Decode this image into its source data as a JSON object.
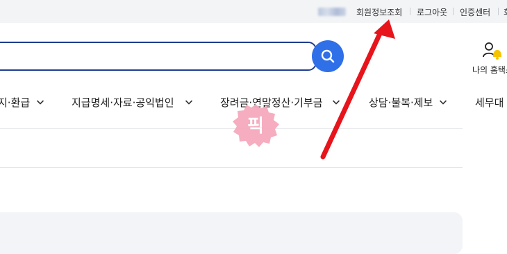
{
  "topbar": {
    "member_info": "회원정보조회",
    "logout": "로그아웃",
    "cert_center": "인증센터",
    "cut_link": "회"
  },
  "search": {
    "value": "",
    "button_icon": "search-icon"
  },
  "my_home": {
    "label": "나의 홈택스",
    "icon": "person-bell-icon"
  },
  "nav": {
    "items": [
      {
        "label": "지·환급"
      },
      {
        "label": "지급명세·자료·공익법인"
      },
      {
        "label": "장려금·연말정산·기부금"
      },
      {
        "label": "상담·불복·제보"
      },
      {
        "label": "세무대"
      }
    ]
  },
  "overlay": {
    "sticker_text": "픽",
    "sticker_color": "#f6a9bd",
    "arrow_color": "#e8141b"
  },
  "colors": {
    "accent": "#2f6fe8",
    "search_border": "#1f3d8f"
  }
}
